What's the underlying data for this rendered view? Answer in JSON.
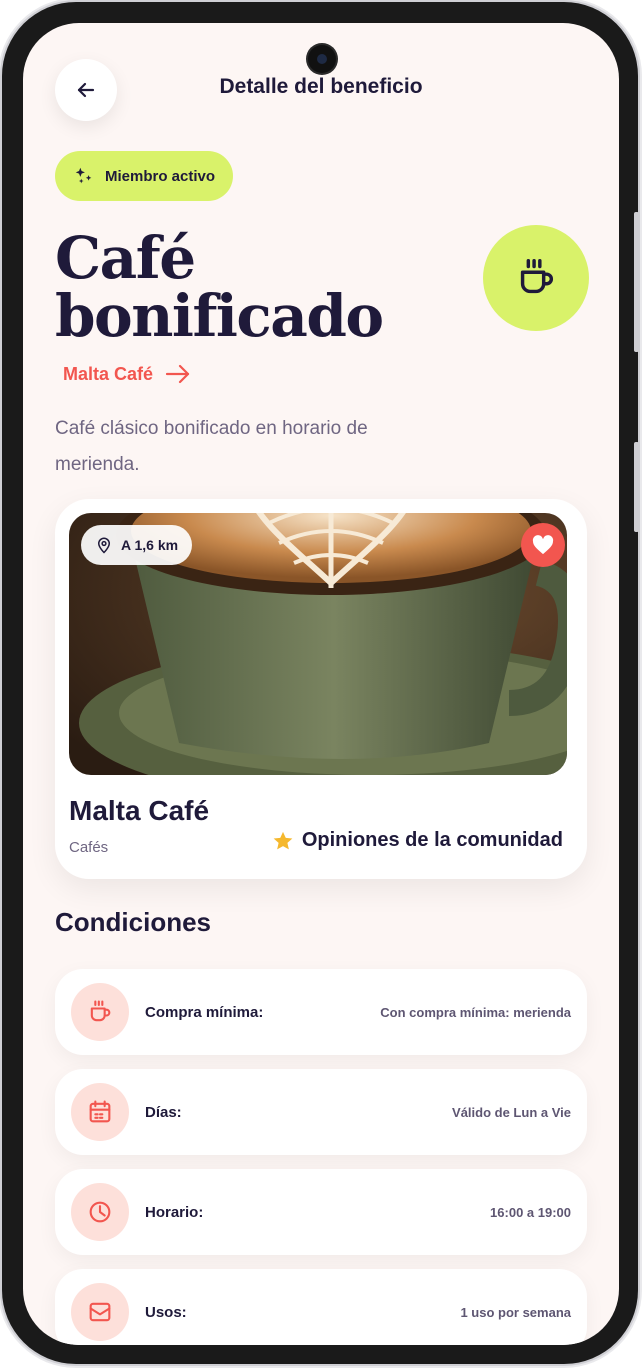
{
  "header": {
    "title": "Detalle del beneficio"
  },
  "badge": {
    "label": "Miembro activo",
    "icon": "sparkles-icon"
  },
  "benefit": {
    "title": "Café bonificado",
    "store_link": "Malta Café",
    "description": "Café clásico bonificado en horario de merienda."
  },
  "store_card": {
    "distance": "A 1,6 km",
    "name": "Malta Café",
    "category": "Cafés",
    "reviews_label": "Opiniones de la comunidad"
  },
  "conditions": {
    "title": "Condiciones",
    "items": [
      {
        "label": "Compra mínima:",
        "value": "Con compra mínima: merienda",
        "icon": "cup-icon"
      },
      {
        "label": "Días:",
        "value": "Válido de Lun a Vie",
        "icon": "calendar-icon"
      },
      {
        "label": "Horario:",
        "value": "16:00 a 19:00",
        "icon": "clock-icon"
      },
      {
        "label": "Usos:",
        "value": "1 uso por semana",
        "icon": "ticket-icon"
      }
    ]
  },
  "colors": {
    "accent": "#f2564f",
    "lime": "#d9f26a",
    "ink": "#1f1a3a",
    "background": "#fdf6f4"
  }
}
